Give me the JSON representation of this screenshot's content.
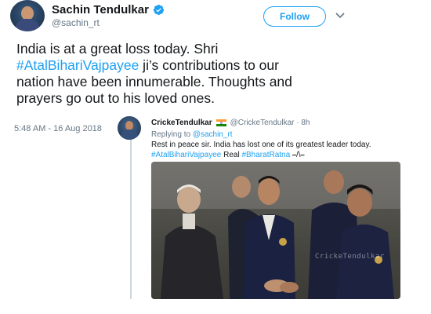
{
  "tweet": {
    "display_name": "Sachin Tendulkar",
    "handle": "@sachin_rt",
    "follow_label": "Follow",
    "text_parts": [
      "India is at a great loss today. Shri ",
      "#AtalBihariVajpayee",
      " ji’s contributions to our nation have been innumerable. Thoughts and prayers go out to his loved ones."
    ],
    "timestamp": "5:48 AM - 16 Aug 2018"
  },
  "quote": {
    "name": "CrickeTendulkar",
    "handle": "@CrickeTendulkar · 8h",
    "replying_prefix": "Replying to ",
    "replying_to": "@sachin_rt",
    "line1": "Rest in peace sir. India has lost one of its greatest leader today.",
    "line2_tag1": "#AtalBihariVajpayee",
    "line2_mid": " Real ",
    "line2_tag2": "#BharatRatna",
    "line2_end": " ⎯/\\⎯",
    "photo_watermark": "CrickeTendulkar"
  },
  "colors": {
    "accent": "#1da1f2",
    "secondary_text": "#657786",
    "primary_text": "#14171a",
    "divider": "#ccd6dd"
  },
  "icons": {
    "verified": "verified-badge-icon",
    "menu": "chevron-down-icon",
    "flag": "india-flag-icon"
  }
}
